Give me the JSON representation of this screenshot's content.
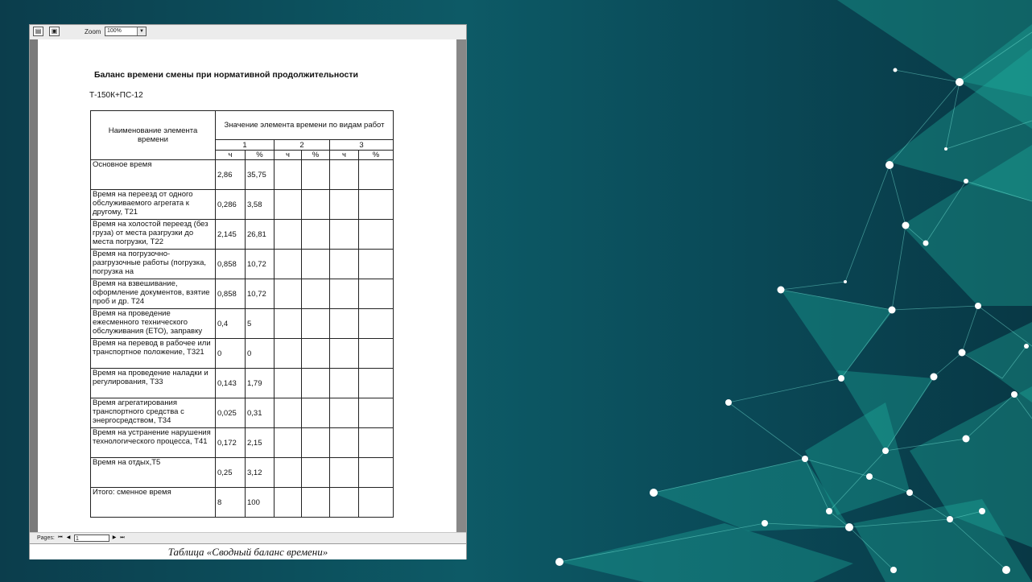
{
  "viewer": {
    "zoom_label": "Zoom",
    "zoom_value": "100%",
    "pages_label": "Pages:",
    "page_number": "1"
  },
  "document": {
    "title": "Баланс времени смены при нормативной продолжительности",
    "subtitle": "Т-150К+ПС-12",
    "table": {
      "header_name": "Наименование элемента времени",
      "header_values": "Значение элемента времени по видам работ",
      "groups": [
        "1",
        "2",
        "3"
      ],
      "units": [
        "ч",
        "%",
        "ч",
        "%",
        "ч",
        "%"
      ],
      "rows": [
        {
          "name": "Основное время",
          "h": "2,86",
          "p": "35,75"
        },
        {
          "name": "Время на переезд от одного обслуживаемого агрегата к другому, Т21",
          "h": "0,286",
          "p": "3,58"
        },
        {
          "name": "Время на холостой переезд (без груза) от места разгрузки до места погрузки, Т22",
          "h": "2,145",
          "p": "26,81"
        },
        {
          "name": "Время на погрузочно-разгрузочные работы (погрузка, погрузка на",
          "h": "0,858",
          "p": "10,72"
        },
        {
          "name": "Время на взвешивание, оформление документов, взятие проб и др. Т24",
          "h": "0,858",
          "p": "10,72"
        },
        {
          "name": "Время на проведение ежесменного технического обслуживания (ЕТО), заправку",
          "h": "0,4",
          "p": "5"
        },
        {
          "name": "Время на перевод в рабочее или транспортное положение, Т321",
          "h": "0",
          "p": "0"
        },
        {
          "name": "Время на проведение наладки и регулирования, Т33",
          "h": "0,143",
          "p": "1,79"
        },
        {
          "name": "Время агрегатирования транспортного средства с энергосредством, Т34",
          "h": "0,025",
          "p": "0,31"
        },
        {
          "name": "Время на устранение нарушения технологического процесса, Т41",
          "h": "0,172",
          "p": "2,15"
        },
        {
          "name": "Время на отдых,Т5",
          "h": "0,25",
          "p": "3,12"
        },
        {
          "name": "Итого: сменное время",
          "h": "8",
          "p": "100"
        }
      ]
    }
  },
  "caption": "Таблица «Сводный баланс времени»",
  "colors": {
    "background": "#0b4a58",
    "network_accent": "#3fd6c2"
  }
}
